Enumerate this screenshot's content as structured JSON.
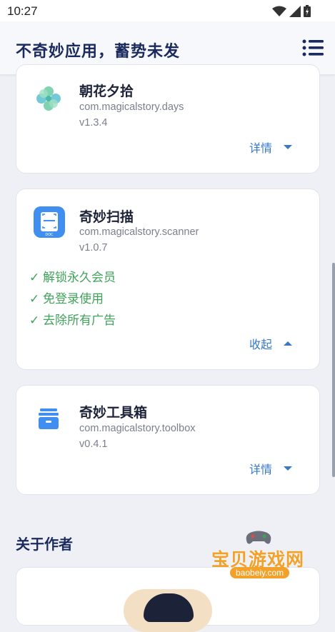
{
  "status_bar": {
    "time": "10:27"
  },
  "app_bar": {
    "title": "不奇妙应用，蓄势未发"
  },
  "apps": [
    {
      "name": "朝花夕拾",
      "package": "com.magicalstory.days",
      "version": "v1.3.4",
      "toggle_label": "详情",
      "expanded": false,
      "features": []
    },
    {
      "name": "奇妙扫描",
      "package": "com.magicalstory.scanner",
      "version": "v1.0.7",
      "toggle_label": "收起",
      "expanded": true,
      "features": [
        "✓ 解锁永久会员",
        "✓ 免登录使用",
        "✓ 去除所有广告"
      ]
    },
    {
      "name": "奇妙工具箱",
      "package": "com.magicalstory.toolbox",
      "version": "v0.4.1",
      "toggle_label": "详情",
      "expanded": false,
      "features": []
    }
  ],
  "about": {
    "title": "关于作者"
  },
  "watermark": {
    "brand": "宝贝游戏网",
    "url": "baobeiy.com"
  },
  "colors": {
    "accent": "#3679c8",
    "feature_green": "#3fa35a",
    "title_navy": "#1a2a5e"
  }
}
